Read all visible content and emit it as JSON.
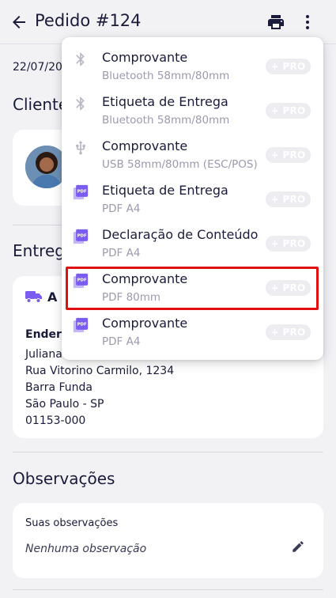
{
  "header": {
    "title": "Pedido #124",
    "back_icon": "arrow-back-icon",
    "print_icon": "printer-icon",
    "more_icon": "more-vertical-icon"
  },
  "order": {
    "date": "22/07/20"
  },
  "client_section": {
    "title": "Cliente"
  },
  "delivery_section": {
    "title": "Entrega",
    "method_label": "A C",
    "address_heading": "Endere",
    "address_lines": [
      "Juliana S",
      "Rua Vitorino Carmilo, 1234",
      "Barra Funda",
      "São Paulo - SP",
      "01153-000"
    ]
  },
  "observations": {
    "title": "Observações",
    "label": "Suas observações",
    "value": "Nenhuma observação",
    "edit_icon": "pencil-icon"
  },
  "print_menu": {
    "pro_badge": "+ PRO",
    "items": [
      {
        "label": "Comprovante",
        "sublabel": "Bluetooth 58mm/80mm",
        "icon": "bluetooth-icon"
      },
      {
        "label": "Etiqueta de Entrega",
        "sublabel": "Bluetooth 58mm/80mm",
        "icon": "bluetooth-icon"
      },
      {
        "label": "Comprovante",
        "sublabel": "USB 58mm/80mm (ESC/POS)",
        "icon": "usb-icon"
      },
      {
        "label": "Etiqueta de Entrega",
        "sublabel": "PDF A4",
        "icon": "pdf-icon"
      },
      {
        "label": "Declaração de Conteúdo",
        "sublabel": "PDF A4",
        "icon": "pdf-icon"
      },
      {
        "label": "Comprovante",
        "sublabel": "PDF 80mm",
        "icon": "pdf-icon"
      },
      {
        "label": "Comprovante",
        "sublabel": "PDF A4",
        "icon": "pdf-icon"
      }
    ]
  },
  "colors": {
    "accent": "#7b5cf0",
    "text": "#1a1b3a",
    "muted": "#9a9aae",
    "highlight": "#e01010"
  }
}
